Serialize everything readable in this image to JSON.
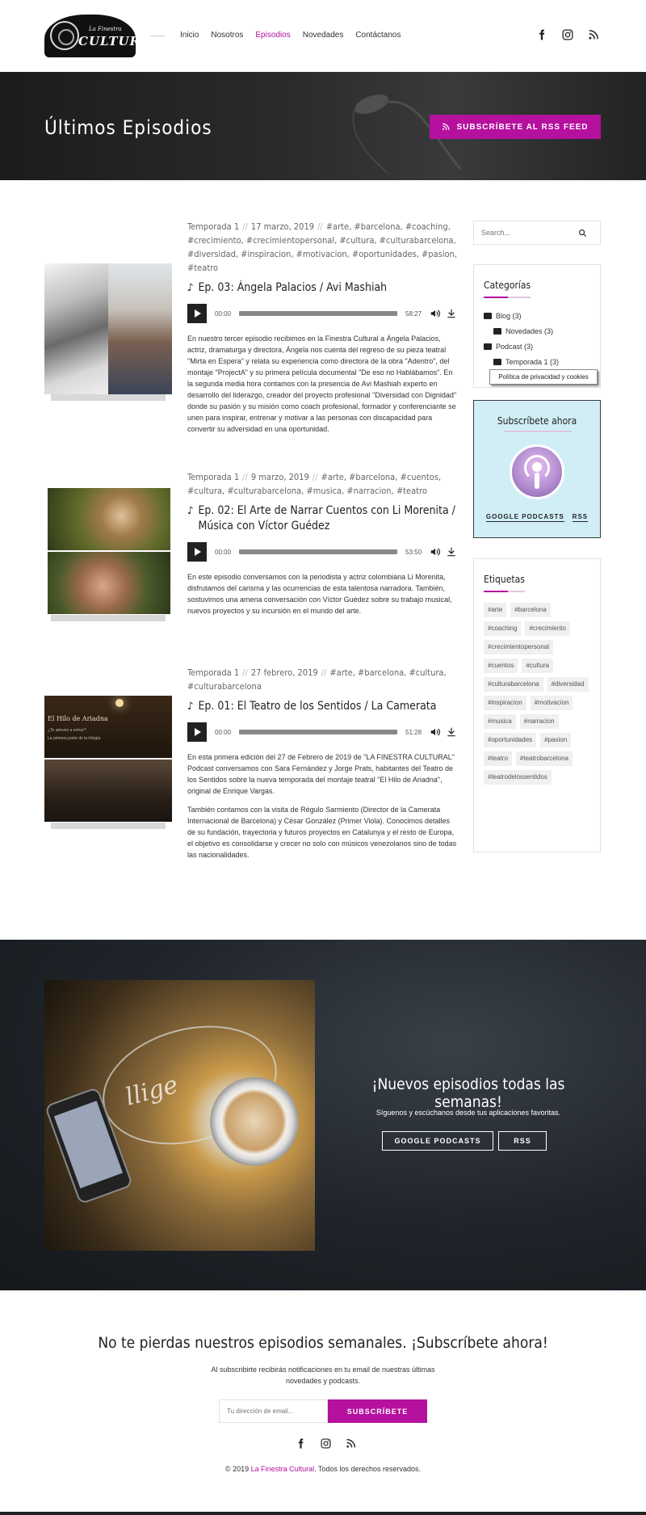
{
  "header": {
    "logo_small": "La Finestra",
    "logo_big": "CULTURAL",
    "nav": [
      "Inicio",
      "Nosotros",
      "Episodios",
      "Novedades",
      "Contáctanos"
    ],
    "active_nav": "Episodios"
  },
  "banner": {
    "title": "Últimos Episodios",
    "rss_button": "SUBSCRÍBETE AL RSS FEED"
  },
  "episodes": [
    {
      "season": "Temporada 1",
      "date": "17 marzo, 2019",
      "tags": "#arte, #barcelona, #coaching, #crecimiento, #crecimientopersonal, #cultura, #culturabarcelona, #diversidad, #inspiracion, #motivacion, #oportunidades, #pasion, #teatro",
      "title": "Ep. 03: Ángela Palacios / Avi Mashiah",
      "time": "00:00",
      "duration": "58:27",
      "description": [
        "En nuestro tercer episodio recibimos en la Finestra Cultural a Ángela Palacios, actriz, dramaturga y directora, Ángela nos cuenta del regreso de su pieza teatral \"Mirta en Espera\" y relata su experiencia como directora de la obra \"Adentro\", del montaje \"ProjectA\" y su primera película documental \"De eso no Hablábamos\". En la segunda media hora contamos con la presencia de Avi Mashiah experto en desarrollo del liderazgo, creador del proyecto profesional \"Diversidad con Dignidad\" donde su pasión y su misión como coach profesional, formador y conferenciante se unen para inspirar, entrenar y motivar a las personas con discapacidad para convertir su adversidad en una oportunidad."
      ]
    },
    {
      "season": "Temporada 1",
      "date": "9 marzo, 2019",
      "tags": "#arte, #barcelona, #cuentos, #cultura, #culturabarcelona, #musica, #narracion, #teatro",
      "title": "Ep. 02: El Arte de Narrar Cuentos con Li Morenita / Música con Víctor Guédez",
      "time": "00:00",
      "duration": "53:50",
      "description": [
        "En este episodio conversamos con la periodista y actriz colombiana Li Morenita, disfrutamos del carisma y las ocurrencias de esta talentosa narradora. También, sostuvimos una amena conversación con Víctor Guédez sobre su trabajo musical, nuevos proyectos y su incursión en el mundo del arte."
      ]
    },
    {
      "season": "Temporada 1",
      "date": "27 febrero, 2019",
      "tags": "#arte, #barcelona, #cultura, #culturabarcelona",
      "title": "Ep. 01: El Teatro de los Sentidos / La Camerata",
      "time": "00:00",
      "duration": "51:28",
      "description": [
        "En esta primera edición del 27 de Febrero de 2019 de \"LA FINESTRA CULTURAL\" Podcast conversamos con Sara Fernández y Jorge Prats, habitantes del Teatro de los Sentidos sobre la nueva temporada del montaje teatral \"El Hilo de Ariadna\", original de Enrique Vargas.",
        "También contamos con la visita de Régulo Sarmiento (Director de la Camerata Internacional de Barcelona) y César González (Primer Viola). Conocimos detalles de su fundación, trayectoria y futuros proyectos en Catalunya y el resto de Europa, el objetivo es consolidarse y crecer no solo con músicos venezolanos sino de todas las nacionalidades."
      ],
      "image_text": [
        "El Hilo de Ariadna",
        "¿Te atreves a entrar?",
        "La primera parte de la trilogía"
      ]
    }
  ],
  "sidebar": {
    "search_placeholder": "Search...",
    "categories_title": "Categorías",
    "categories": [
      {
        "label": "Blog (3)",
        "level": 0
      },
      {
        "label": "Novedades (3)",
        "level": 1
      },
      {
        "label": "Podcast (3)",
        "level": 0
      },
      {
        "label": "Temporada 1 (3)",
        "level": 1
      }
    ],
    "tooltip": "Política de privacidad y cookies",
    "subscribe_title": "Subscríbete ahora",
    "subscribe_links": [
      "GOOGLE PODCASTS",
      "RSS"
    ],
    "tags_title": "Etiquetas",
    "tags": [
      "#arte",
      "#barcelona",
      "#coaching",
      "#crecimiento",
      "#crecimientopersonal",
      "#cuentos",
      "#cultura",
      "#culturabarcelona",
      "#diversidad",
      "#inspiracion",
      "#motivacion",
      "#musica",
      "#narracion",
      "#oportunidades",
      "#pasion",
      "#teatro",
      "#teatrobarcelona",
      "#teatrodelossentidos"
    ]
  },
  "promo": {
    "title": "¡Nuevos episodios todas las semanas!",
    "subtitle": "Síguenos y escúchanos desde tus aplicaciones favoritas.",
    "buttons": [
      "GOOGLE PODCASTS",
      "RSS"
    ],
    "photo_text": "llige"
  },
  "newsletter": {
    "title": "No te pierdas nuestros episodios semanales. ¡Subscríbete ahora!",
    "description": "Al subscribirte recibirás notificaciones en tu email de nuestras últimas novedades y podcasts.",
    "placeholder": "Tu dirección de email...",
    "button": "SUBSCRÍBETE"
  },
  "footer": {
    "copy_prefix": "© 2019 ",
    "brand": "La Finestra Cultural",
    "copy_suffix": ". Todos los derechos reservados."
  },
  "colors": {
    "accent": "#b5109e",
    "dark": "#222222",
    "subscribe_bg": "#d1eef7"
  }
}
